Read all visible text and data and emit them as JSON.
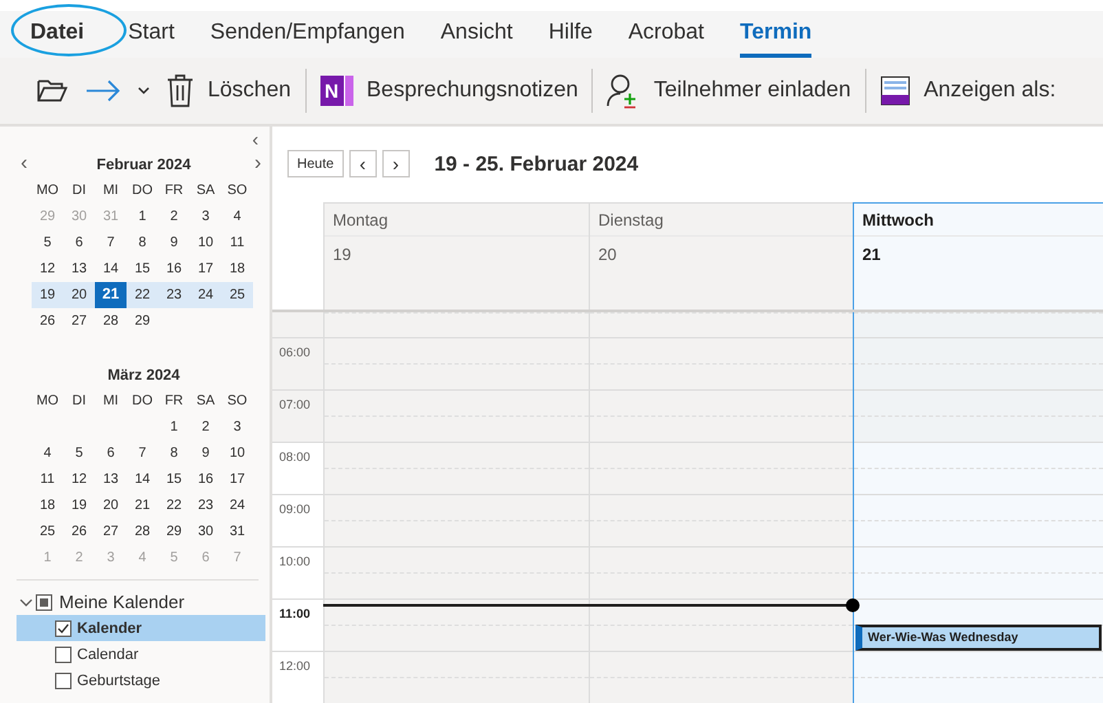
{
  "tabs": [
    {
      "label": "Datei",
      "selected": false,
      "circled": true
    },
    {
      "label": "Start",
      "selected": false,
      "circled": false
    },
    {
      "label": "Senden/Empfangen",
      "selected": false,
      "circled": false
    },
    {
      "label": "Ansicht",
      "selected": false,
      "circled": false
    },
    {
      "label": "Hilfe",
      "selected": false,
      "circled": false
    },
    {
      "label": "Acrobat",
      "selected": false,
      "circled": false
    },
    {
      "label": "Termin",
      "selected": true,
      "circled": false
    }
  ],
  "toolbar": [
    {
      "kind": "open"
    },
    {
      "kind": "forward"
    },
    {
      "kind": "dropdown"
    },
    {
      "kind": "delete",
      "label": "Löschen"
    },
    {
      "kind": "separator"
    },
    {
      "kind": "notes",
      "label": "Besprechungsnotizen",
      "logo_text": "N"
    },
    {
      "kind": "separator"
    },
    {
      "kind": "invite",
      "label": "Teilnehmer einladen"
    },
    {
      "kind": "separator"
    },
    {
      "kind": "view",
      "label": "Anzeigen als:"
    }
  ],
  "sidebar": {
    "collapse": "‹",
    "prev": "‹",
    "next": "›",
    "months": [
      {
        "title": "Februar 2024",
        "nav": true,
        "weekdays": [
          "MO",
          "DI",
          "MI",
          "DO",
          "FR",
          "SA",
          "SO"
        ],
        "weeks": [
          {
            "selected": false,
            "days": [
              {
                "label": "29",
                "muted": true,
                "selected": false
              },
              {
                "label": "30",
                "muted": true,
                "selected": false
              },
              {
                "label": "31",
                "muted": true,
                "selected": false
              },
              {
                "label": "1",
                "muted": false,
                "selected": false
              },
              {
                "label": "2",
                "muted": false,
                "selected": false
              },
              {
                "label": "3",
                "muted": false,
                "selected": false
              },
              {
                "label": "4",
                "muted": false,
                "selected": false
              }
            ]
          },
          {
            "selected": false,
            "days": [
              {
                "label": "5",
                "muted": false,
                "selected": false
              },
              {
                "label": "6",
                "muted": false,
                "selected": false
              },
              {
                "label": "7",
                "muted": false,
                "selected": false
              },
              {
                "label": "8",
                "muted": false,
                "selected": false
              },
              {
                "label": "9",
                "muted": false,
                "selected": false
              },
              {
                "label": "10",
                "muted": false,
                "selected": false
              },
              {
                "label": "11",
                "muted": false,
                "selected": false
              }
            ]
          },
          {
            "selected": false,
            "days": [
              {
                "label": "12",
                "muted": false,
                "selected": false
              },
              {
                "label": "13",
                "muted": false,
                "selected": false
              },
              {
                "label": "14",
                "muted": false,
                "selected": false
              },
              {
                "label": "15",
                "muted": false,
                "selected": false
              },
              {
                "label": "16",
                "muted": false,
                "selected": false
              },
              {
                "label": "17",
                "muted": false,
                "selected": false
              },
              {
                "label": "18",
                "muted": false,
                "selected": false
              }
            ]
          },
          {
            "selected": true,
            "days": [
              {
                "label": "19",
                "muted": false,
                "selected": false
              },
              {
                "label": "20",
                "muted": false,
                "selected": false
              },
              {
                "label": "21",
                "muted": false,
                "selected": true
              },
              {
                "label": "22",
                "muted": false,
                "selected": false
              },
              {
                "label": "23",
                "muted": false,
                "selected": false
              },
              {
                "label": "24",
                "muted": false,
                "selected": false
              },
              {
                "label": "25",
                "muted": false,
                "selected": false
              }
            ]
          },
          {
            "selected": false,
            "days": [
              {
                "label": "26",
                "muted": false,
                "selected": false
              },
              {
                "label": "27",
                "muted": false,
                "selected": false
              },
              {
                "label": "28",
                "muted": false,
                "selected": false
              },
              {
                "label": "29",
                "muted": false,
                "selected": false
              }
            ]
          }
        ]
      },
      {
        "title": "März 2024",
        "nav": false,
        "weekdays": [
          "MO",
          "DI",
          "MI",
          "DO",
          "FR",
          "SA",
          "SO"
        ],
        "weeks": [
          {
            "selected": false,
            "align_end": true,
            "days": [
              {
                "label": "1",
                "muted": false,
                "selected": false
              },
              {
                "label": "2",
                "muted": false,
                "selected": false
              },
              {
                "label": "3",
                "muted": false,
                "selected": false
              }
            ]
          },
          {
            "selected": false,
            "days": [
              {
                "label": "4",
                "muted": false,
                "selected": false
              },
              {
                "label": "5",
                "muted": false,
                "selected": false
              },
              {
                "label": "6",
                "muted": false,
                "selected": false
              },
              {
                "label": "7",
                "muted": false,
                "selected": false
              },
              {
                "label": "8",
                "muted": false,
                "selected": false
              },
              {
                "label": "9",
                "muted": false,
                "selected": false
              },
              {
                "label": "10",
                "muted": false,
                "selected": false
              }
            ]
          },
          {
            "selected": false,
            "days": [
              {
                "label": "11",
                "muted": false,
                "selected": false
              },
              {
                "label": "12",
                "muted": false,
                "selected": false
              },
              {
                "label": "13",
                "muted": false,
                "selected": false
              },
              {
                "label": "14",
                "muted": false,
                "selected": false
              },
              {
                "label": "15",
                "muted": false,
                "selected": false
              },
              {
                "label": "16",
                "muted": false,
                "selected": false
              },
              {
                "label": "17",
                "muted": false,
                "selected": false
              }
            ]
          },
          {
            "selected": false,
            "days": [
              {
                "label": "18",
                "muted": false,
                "selected": false
              },
              {
                "label": "19",
                "muted": false,
                "selected": false
              },
              {
                "label": "20",
                "muted": false,
                "selected": false
              },
              {
                "label": "21",
                "muted": false,
                "selected": false
              },
              {
                "label": "22",
                "muted": false,
                "selected": false
              },
              {
                "label": "23",
                "muted": false,
                "selected": false
              },
              {
                "label": "24",
                "muted": false,
                "selected": false
              }
            ]
          },
          {
            "selected": false,
            "days": [
              {
                "label": "25",
                "muted": false,
                "selected": false
              },
              {
                "label": "26",
                "muted": false,
                "selected": false
              },
              {
                "label": "27",
                "muted": false,
                "selected": false
              },
              {
                "label": "28",
                "muted": false,
                "selected": false
              },
              {
                "label": "29",
                "muted": false,
                "selected": false
              },
              {
                "label": "30",
                "muted": false,
                "selected": false
              },
              {
                "label": "31",
                "muted": false,
                "selected": false
              }
            ]
          },
          {
            "selected": false,
            "days": [
              {
                "label": "1",
                "muted": true,
                "selected": false
              },
              {
                "label": "2",
                "muted": true,
                "selected": false
              },
              {
                "label": "3",
                "muted": true,
                "selected": false
              },
              {
                "label": "4",
                "muted": true,
                "selected": false
              },
              {
                "label": "5",
                "muted": true,
                "selected": false
              },
              {
                "label": "6",
                "muted": true,
                "selected": false
              },
              {
                "label": "7",
                "muted": true,
                "selected": false
              }
            ]
          }
        ]
      }
    ],
    "calendar_group": {
      "label": "Meine Kalender",
      "expanded": true,
      "checked": true,
      "items": [
        {
          "label": "Kalender",
          "checked": true,
          "selected": true
        },
        {
          "label": "Calendar",
          "checked": false,
          "selected": false
        },
        {
          "label": "Geburtstage",
          "checked": false,
          "selected": false
        }
      ]
    }
  },
  "view": {
    "today_button": "Heute",
    "prev": "‹",
    "next": "›",
    "range": "19 - 25. Februar 2024",
    "days": [
      {
        "name": "Montag",
        "date": "19",
        "today": false
      },
      {
        "name": "Dienstag",
        "date": "20",
        "today": false
      },
      {
        "name": "Mittwoch",
        "date": "21",
        "today": true
      }
    ],
    "times": [
      {
        "label": "06:00",
        "work_hours": false,
        "current": false
      },
      {
        "label": "07:00",
        "work_hours": false,
        "current": false
      },
      {
        "label": "08:00",
        "work_hours": true,
        "current": false
      },
      {
        "label": "09:00",
        "work_hours": true,
        "current": false
      },
      {
        "label": "10:00",
        "work_hours": true,
        "current": false
      },
      {
        "label": "11:00",
        "work_hours": true,
        "current": true,
        "events": [
          {
            "title": "Wer-Wie-Was Wednesday",
            "selected": true,
            "second_half": true
          }
        ]
      },
      {
        "label": "12:00",
        "work_hours": true,
        "current": false
      }
    ]
  }
}
